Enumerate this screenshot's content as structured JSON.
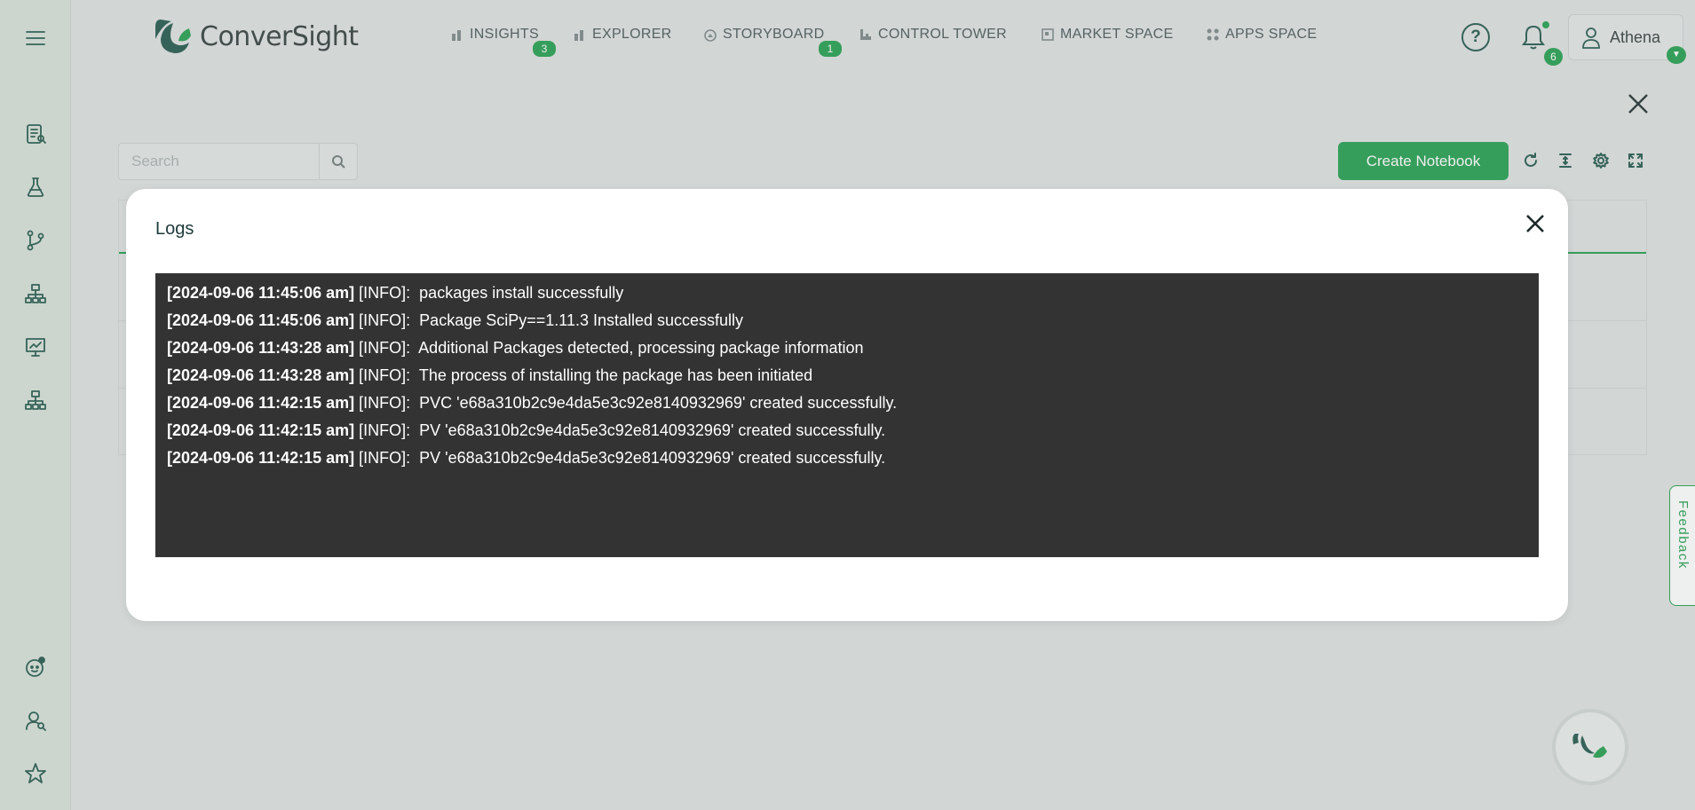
{
  "app": {
    "brand": "ConverSight"
  },
  "nav": {
    "items": [
      {
        "label": "INSIGHTS",
        "badge": "3",
        "icon": "bar-chart-icon"
      },
      {
        "label": "EXPLORER",
        "badge": "",
        "icon": "bar-chart-icon"
      },
      {
        "label": "STORYBOARD",
        "badge": "1",
        "icon": "storyboard-icon"
      },
      {
        "label": "CONTROL TOWER",
        "badge": "",
        "icon": "tower-icon"
      },
      {
        "label": "MARKET SPACE",
        "badge": "",
        "icon": "market-icon"
      },
      {
        "label": "APPS SPACE",
        "badge": "",
        "icon": "grid-icon"
      }
    ]
  },
  "header": {
    "help_label": "?",
    "notification_count": "6",
    "user_name": "Athena"
  },
  "toolbar": {
    "search_placeholder": "Search",
    "create_label": "Create Notebook"
  },
  "modal": {
    "title": "Logs",
    "logs": [
      {
        "ts": "[2024-09-06 11:45:06 am]",
        "level": "[INFO]:",
        "msg": "packages install successfully"
      },
      {
        "ts": "[2024-09-06 11:45:06 am]",
        "level": "[INFO]:",
        "msg": "Package SciPy==1.11.3 Installed successfully"
      },
      {
        "ts": "[2024-09-06 11:43:28 am]",
        "level": "[INFO]:",
        "msg": "Additional Packages detected, processing package information"
      },
      {
        "ts": "[2024-09-06 11:43:28 am]",
        "level": "[INFO]:",
        "msg": "The process of installing the package has been initiated"
      },
      {
        "ts": "[2024-09-06 11:42:15 am]",
        "level": "[INFO]:",
        "msg": "PVC 'e68a310b2c9e4da5e3c92e8140932969' created successfully."
      },
      {
        "ts": "[2024-09-06 11:42:15 am]",
        "level": "[INFO]:",
        "msg": "PV 'e68a310b2c9e4da5e3c92e8140932969' created successfully."
      },
      {
        "ts": "[2024-09-06 11:42:15 am]",
        "level": "[INFO]:",
        "msg": "PV 'e68a310b2c9e4da5e3c92e8140932969' created successfully."
      }
    ]
  },
  "feedback_label": "Feedback",
  "colors": {
    "accent": "#1f9d4b",
    "log_bg": "#333333",
    "rail_bg": "#d6e1d7"
  }
}
